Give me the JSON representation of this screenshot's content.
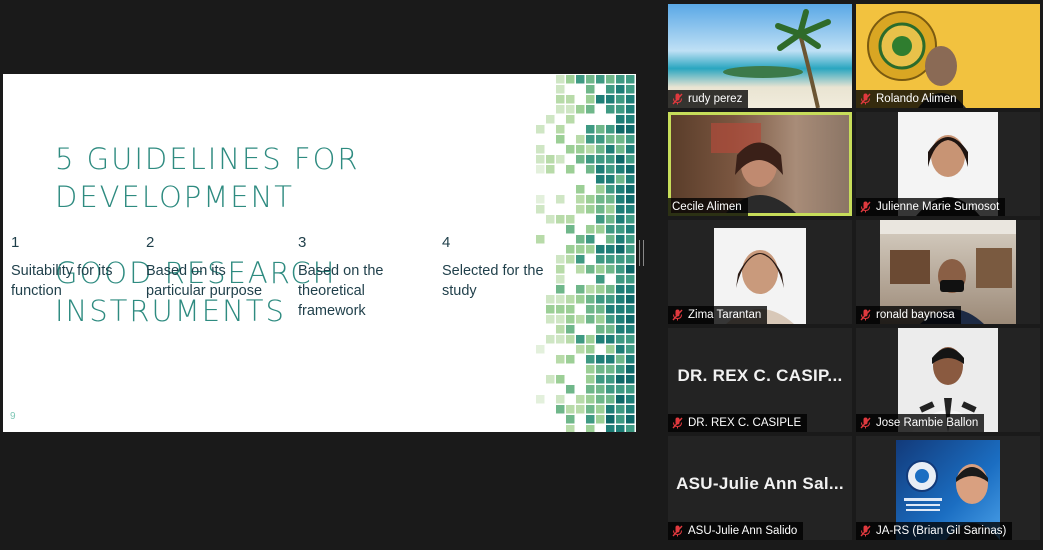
{
  "slide": {
    "title_line1": "5 GUIDELINES FOR DEVELOPMENT",
    "title_line2": "GOOD RESEARCH INSTRUMENTS",
    "guidelines": [
      {
        "num": "1",
        "text": "Suitability for its function"
      },
      {
        "num": "2",
        "text": "Based on its particular purpose"
      },
      {
        "num": "3",
        "text": "Based on the theoretical framework"
      },
      {
        "num": "4",
        "text": "Selected for the study"
      }
    ],
    "page_number": "9"
  },
  "participants": [
    {
      "name": "rudy perez",
      "muted": true,
      "video": true
    },
    {
      "name": "Rolando Alimen",
      "muted": true,
      "video": true
    },
    {
      "name": "Cecile Alimen",
      "muted": false,
      "video": true,
      "active": true
    },
    {
      "name": "Julienne Marie Sumosot",
      "muted": true,
      "video": true
    },
    {
      "name": "Zima Tarantan",
      "muted": true,
      "video": true
    },
    {
      "name": "ronald baynosa",
      "muted": true,
      "video": true
    },
    {
      "name": "DR. REX C. CASIPLE",
      "display": "DR. REX C. CASIP...",
      "muted": true,
      "video": false
    },
    {
      "name": "Jose Rambie Ballon",
      "muted": true,
      "video": true
    },
    {
      "name": "ASU-Julie Ann Salido",
      "display": "ASU-Julie Ann Sal...",
      "muted": true,
      "video": false
    },
    {
      "name": "JA-RS (Brian Gil Sarinas)",
      "muted": true,
      "video": true
    }
  ],
  "colors": {
    "accent": "#2e8b80",
    "active_border": "#c7dd5a",
    "muted_icon": "#e0393e"
  }
}
